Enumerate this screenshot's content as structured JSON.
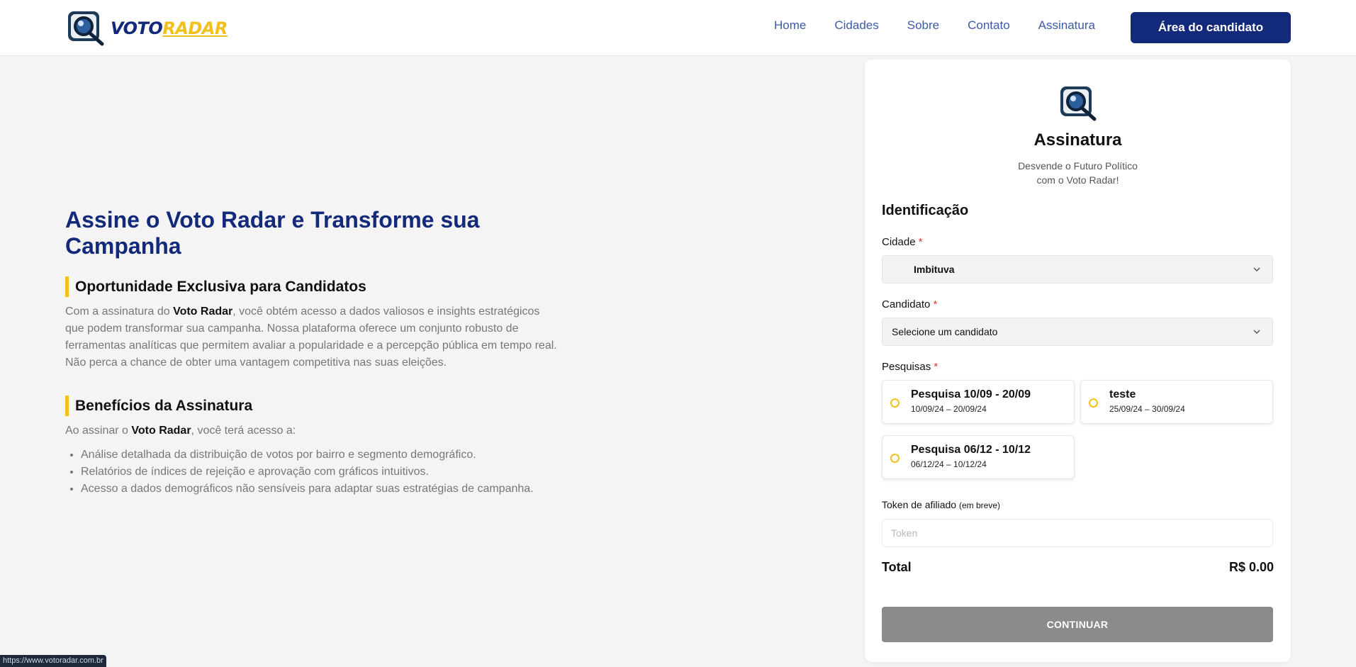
{
  "brand": {
    "part1": "VOTO",
    "part2": "RADAR"
  },
  "nav": [
    "Home",
    "Cidades",
    "Sobre",
    "Contato",
    "Assinatura"
  ],
  "cta_label": "Área do candidato",
  "left": {
    "title": "Assine o Voto Radar e Transforme sua Campanha",
    "section1_title": "Oportunidade Exclusiva para Candidatos",
    "section1_pre": "Com a assinatura do ",
    "section1_bold": "Voto Radar",
    "section1_post": ", você obtém acesso a dados valiosos e insights estratégicos que podem transformar sua campanha. Nossa plataforma oferece um conjunto robusto de ferramentas analíticas que permitem avaliar a popularidade e a percepção pública em tempo real. Não perca a chance de obter uma vantagem competitiva nas suas eleições.",
    "section2_title": "Benefícios da Assinatura",
    "section2_pre": "Ao assinar o ",
    "section2_bold": "Voto Radar",
    "section2_post": ", você terá acesso a:",
    "benefits": [
      "Análise detalhada da distribuição de votos por bairro e segmento demográfico.",
      "Relatórios de índices de rejeição e aprovação com gráficos intuitivos.",
      "Acesso a dados demográficos não sensíveis para adaptar suas estratégias de campanha."
    ]
  },
  "card": {
    "title": "Assinatura",
    "subtitle_line1": "Desvende o Futuro Político",
    "subtitle_line2": "com o Voto Radar!",
    "section": "Identificação",
    "city_label": "Cidade",
    "city_value": "Imbituva",
    "candidate_label": "Candidato",
    "candidate_value": "Selecione um candidato",
    "surveys_label": "Pesquisas",
    "required_mark": "*",
    "surveys": [
      {
        "title": "Pesquisa 10/09 - 20/09",
        "dates": "10/09/24 – 20/09/24"
      },
      {
        "title": "teste",
        "dates": "25/09/24 – 30/09/24"
      },
      {
        "title": "Pesquisa 06/12 - 10/12",
        "dates": "06/12/24 – 10/12/24"
      }
    ],
    "token_label": "Token de afiliado",
    "token_note": "(em breve)",
    "token_placeholder": "Token",
    "total_label": "Total",
    "total_value": "R$ 0.00",
    "continue_label": "CONTINUAR"
  },
  "status_url": "https://www.votoradar.com.br",
  "colors": {
    "primary": "#13297a",
    "accent": "#f2c01d",
    "disabled": "#8b8b8b"
  }
}
